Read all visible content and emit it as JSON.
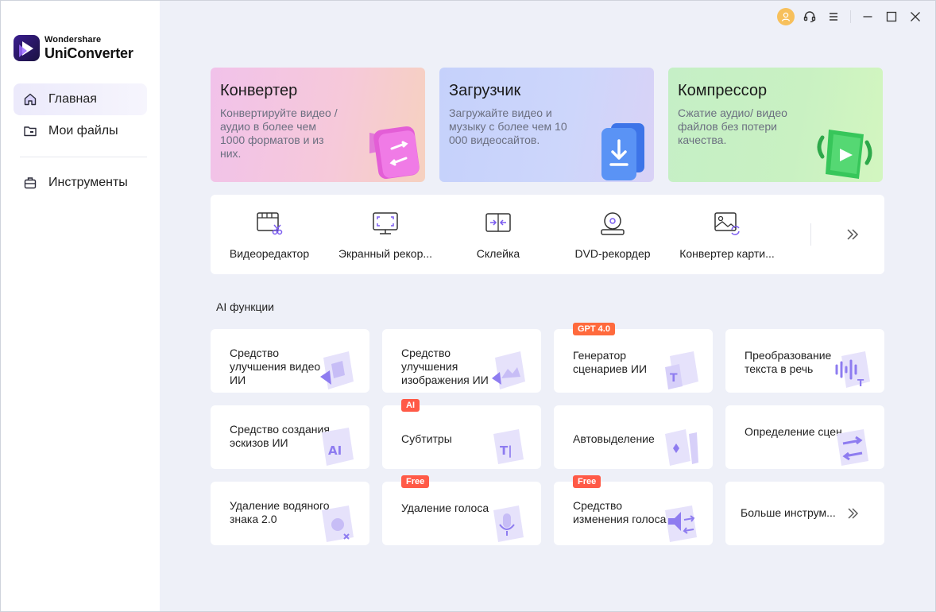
{
  "app": {
    "brand": "Wondershare",
    "product": "UniConverter"
  },
  "sidebar": {
    "items": [
      {
        "label": "Главная",
        "icon": "home-icon",
        "active": true
      },
      {
        "label": "Мои файлы",
        "icon": "folder-icon",
        "active": false
      },
      {
        "label": "Инструменты",
        "icon": "toolbox-icon",
        "active": false
      }
    ]
  },
  "titlebar": {
    "icons": [
      "user-avatar-icon",
      "headset-icon",
      "menu-icon",
      "minimize-icon",
      "maximize-icon",
      "close-icon"
    ]
  },
  "feature_cards": [
    {
      "title": "Конвертер",
      "desc": "Конвертируйте видео / аудио в более чем 1000 форматов и из них.",
      "color": "#f3c6e6"
    },
    {
      "title": "Загрузчик",
      "desc": "Загружайте видео и музыку с более чем 10 000 видеосайтов.",
      "color": "#c9d3fb"
    },
    {
      "title": "Компрессор",
      "desc": "Сжатие аудио/ видео файлов без потери качества.",
      "color": "#cdf3c4"
    }
  ],
  "tools": [
    {
      "label": "Видеоредактор",
      "icon": "video-editor-icon"
    },
    {
      "label": "Экранный рекор...",
      "icon": "screen-recorder-icon"
    },
    {
      "label": "Склейка",
      "icon": "merger-icon"
    },
    {
      "label": "DVD-рекордер",
      "icon": "dvd-burner-icon"
    },
    {
      "label": "Конвертер карти...",
      "icon": "image-converter-icon"
    }
  ],
  "ai_section": {
    "title": "AI функции",
    "cards": [
      {
        "label": "Средство улучшения видео ИИ",
        "badge": "",
        "icon": "ai-video-enhancer-icon"
      },
      {
        "label": "Средство улучшения изображения ИИ",
        "badge": "",
        "icon": "ai-image-enhancer-icon"
      },
      {
        "label": "Генератор сценариев ИИ",
        "badge": "GPT 4.0",
        "icon": "ai-script-generator-icon"
      },
      {
        "label": "Преобразование текста в речь",
        "badge": "",
        "icon": "text-to-speech-icon"
      },
      {
        "label": "Средство создания эскизов ИИ",
        "badge": "",
        "icon": "ai-thumbnail-maker-icon"
      },
      {
        "label": "Субтитры",
        "badge": "AI",
        "icon": "subtitles-icon"
      },
      {
        "label": "Автовыделение",
        "badge": "",
        "icon": "auto-highlight-icon"
      },
      {
        "label": "Определение сцен",
        "badge": "",
        "icon": "scene-detection-icon"
      },
      {
        "label": "Удаление водяного знака 2.0",
        "badge": "",
        "icon": "watermark-remover-icon"
      },
      {
        "label": "Удаление голоса",
        "badge": "Free",
        "icon": "vocal-remover-icon"
      },
      {
        "label": "Средство изменения голоса",
        "badge": "Free",
        "icon": "voice-changer-icon"
      }
    ],
    "more_label": "Больше инструм..."
  }
}
